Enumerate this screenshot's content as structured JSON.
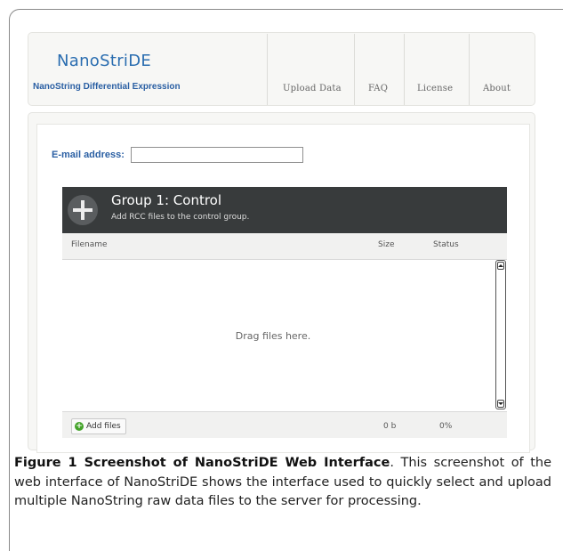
{
  "app": {
    "brand_title": "NanoStriDE",
    "brand_subtitle": "NanoString Differential Expression"
  },
  "nav": {
    "items": [
      {
        "label": "Upload Data"
      },
      {
        "label": "FAQ"
      },
      {
        "label": "License"
      },
      {
        "label": "About"
      }
    ]
  },
  "form": {
    "email_label": "E-mail address:",
    "email_value": ""
  },
  "group": {
    "title": "Group 1: Control",
    "subtitle": "Add RCC files to the control group.",
    "icon": "plus-circle-icon"
  },
  "table": {
    "columns": [
      "Filename",
      "Size",
      "Status"
    ],
    "drop_text": "Drag files here.",
    "add_files_label": "Add files",
    "total_size": "0 b",
    "total_status": "0%"
  },
  "caption": {
    "label": "Figure 1 Screenshot of NanoStriDE Web Interface",
    "text": ". This screenshot of the web interface of NanoStriDE shows the interface used to quickly select and upload multiple NanoString raw data files to the server for processing."
  }
}
